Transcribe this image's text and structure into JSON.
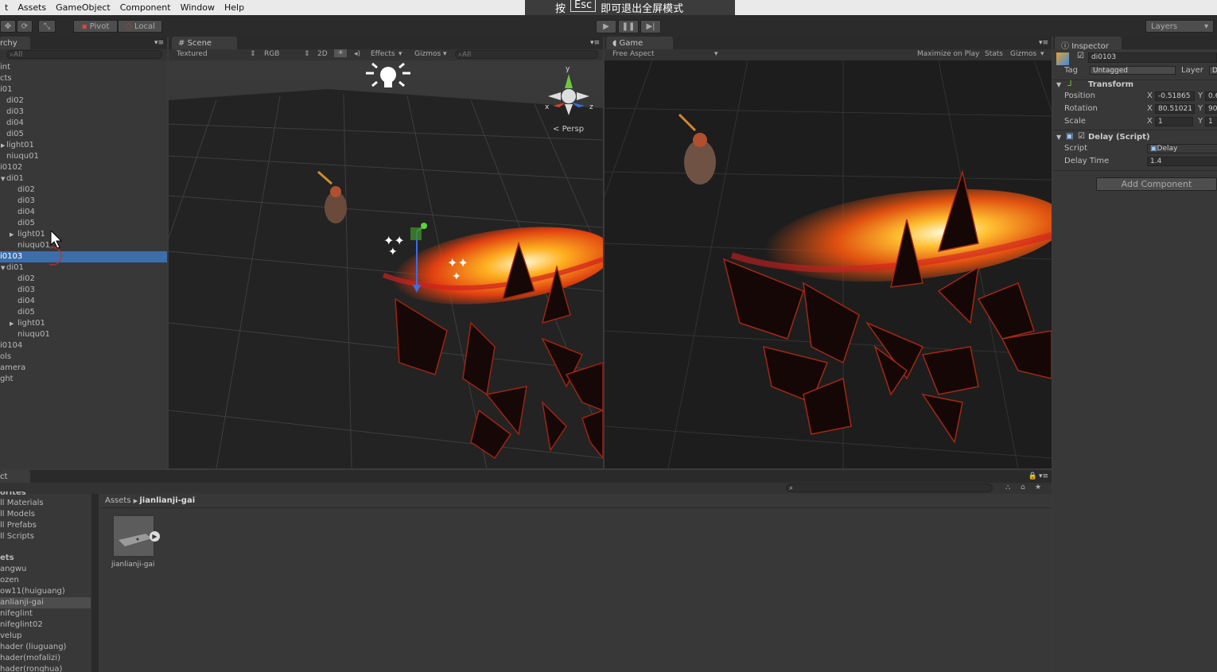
{
  "menu": [
    "t",
    "Assets",
    "GameObject",
    "Component",
    "Window",
    "Help"
  ],
  "fullscreen_tip": {
    "pre": "按",
    "key": "Esc",
    "post": "即可退出全屏模式"
  },
  "toolbar": {
    "pivot": "Pivot",
    "local": "Local",
    "layers": "Layers"
  },
  "hierarchy": {
    "tab": "rchy",
    "search": "All",
    "items": [
      "int",
      "cts",
      "i01",
      "di02",
      "di03",
      "di04",
      "di05",
      "light01",
      "niuqu01",
      "i0102",
      "di01",
      "di02",
      "di03",
      "di04",
      "di05",
      "light01",
      "niuqu01",
      "i0103",
      "di01",
      "di02",
      "di03",
      "di04",
      "di05",
      "light01",
      "niuqu01",
      "i0104",
      "ols",
      "amera",
      "ght"
    ]
  },
  "scene": {
    "tab": "Scene",
    "shading": "Textured",
    "rgb": "RGB",
    "mode2d": "2D",
    "effects": "Effects",
    "gizmos": "Gizmos",
    "search": "All",
    "persp": "Persp",
    "gizmo_y": "y",
    "gizmo_x": "x",
    "gizmo_z": "z"
  },
  "game": {
    "tab": "Game",
    "aspect": "Free Aspect",
    "maximize": "Maximize on Play",
    "stats": "Stats",
    "gizmos": "Gizmos"
  },
  "inspector": {
    "tab": "Inspector",
    "object_name": "di0103",
    "tag_label": "Tag",
    "tag_value": "Untagged",
    "layer_label": "Layer",
    "layer_value": "D",
    "transform_title": "Transform",
    "position_label": "Position",
    "position_x": "-0.51865",
    "position_y": "0.6",
    "rotation_label": "Rotation",
    "rotation_x": "80.51021",
    "rotation_y": "90",
    "scale_label": "Scale",
    "scale_x": "1",
    "scale_y": "1",
    "script_title": "Delay (Script)",
    "script_label": "Script",
    "script_value": "Delay",
    "delay_label": "Delay Time",
    "delay_value": "1.4",
    "add_component": "Add Component",
    "x": "X",
    "y": "Y"
  },
  "project": {
    "tab": "ct",
    "favorites_title": "orites",
    "favorites": [
      "ll Materials",
      "ll Models",
      "ll Prefabs",
      "ll Scripts"
    ],
    "assets_title": "ets",
    "folders": [
      "angwu",
      "ozen",
      "ow11(huiguang)",
      "anlianji-gai",
      "nifeglint",
      "nifeglint02",
      "velup",
      "hader (liuguang)",
      "hader(mofalizi)",
      "hader(ronghua)"
    ],
    "breadcrumb_root": "Assets",
    "breadcrumb_current": "jianlianji-gai",
    "asset_name": "jianlianji-gai"
  }
}
